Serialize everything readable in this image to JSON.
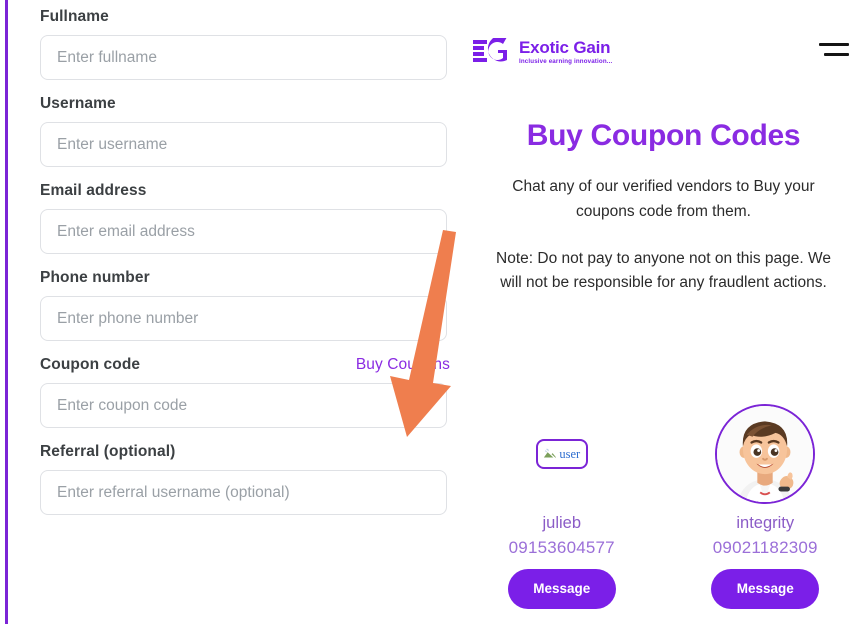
{
  "brand": {
    "accent_purple": "#8a2be2",
    "button_purple": "#7b1fe8",
    "rail_purple": "#7b24d6",
    "arrow_orange": "#ef7e4e",
    "logo_mark": "eg-monogram",
    "logo_title": "Exotic Gain",
    "logo_tagline": "Inclusive earning innovation..."
  },
  "header": {
    "menu_icon": "hamburger-menu-icon"
  },
  "form": {
    "fields": [
      {
        "label": "Fullname",
        "placeholder": "Enter fullname",
        "value": ""
      },
      {
        "label": "Username",
        "placeholder": "Enter username",
        "value": ""
      },
      {
        "label": "Email address",
        "placeholder": "Enter email address",
        "value": ""
      },
      {
        "label": "Phone number",
        "placeholder": "Enter phone number",
        "value": ""
      },
      {
        "label": "Coupon code",
        "placeholder": "Enter coupon code",
        "value": "",
        "link": "Buy Coupons"
      },
      {
        "label": "Referral (optional)",
        "placeholder": "Enter referral username (optional)",
        "value": ""
      }
    ]
  },
  "panel": {
    "headline": "Buy Coupon Codes",
    "subtitle": "Chat any of our verified vendors to Buy your coupons code from them.",
    "note": "Note: Do not pay to anyone not on this page. We will not be responsible for any fraudlent actions."
  },
  "vendors": [
    {
      "avatar_kind": "broken-image",
      "avatar_alt": "user",
      "name": "julieb",
      "phone": "09153604577",
      "button_label": "Message"
    },
    {
      "avatar_kind": "photo",
      "avatar_alt": "cartoon-boy-avatar",
      "name": "integrity",
      "phone": "09021182309",
      "button_label": "Message"
    }
  ],
  "annotation": {
    "arrow_icon": "orange-pointer-arrow",
    "points_to": "Buy Coupons"
  }
}
